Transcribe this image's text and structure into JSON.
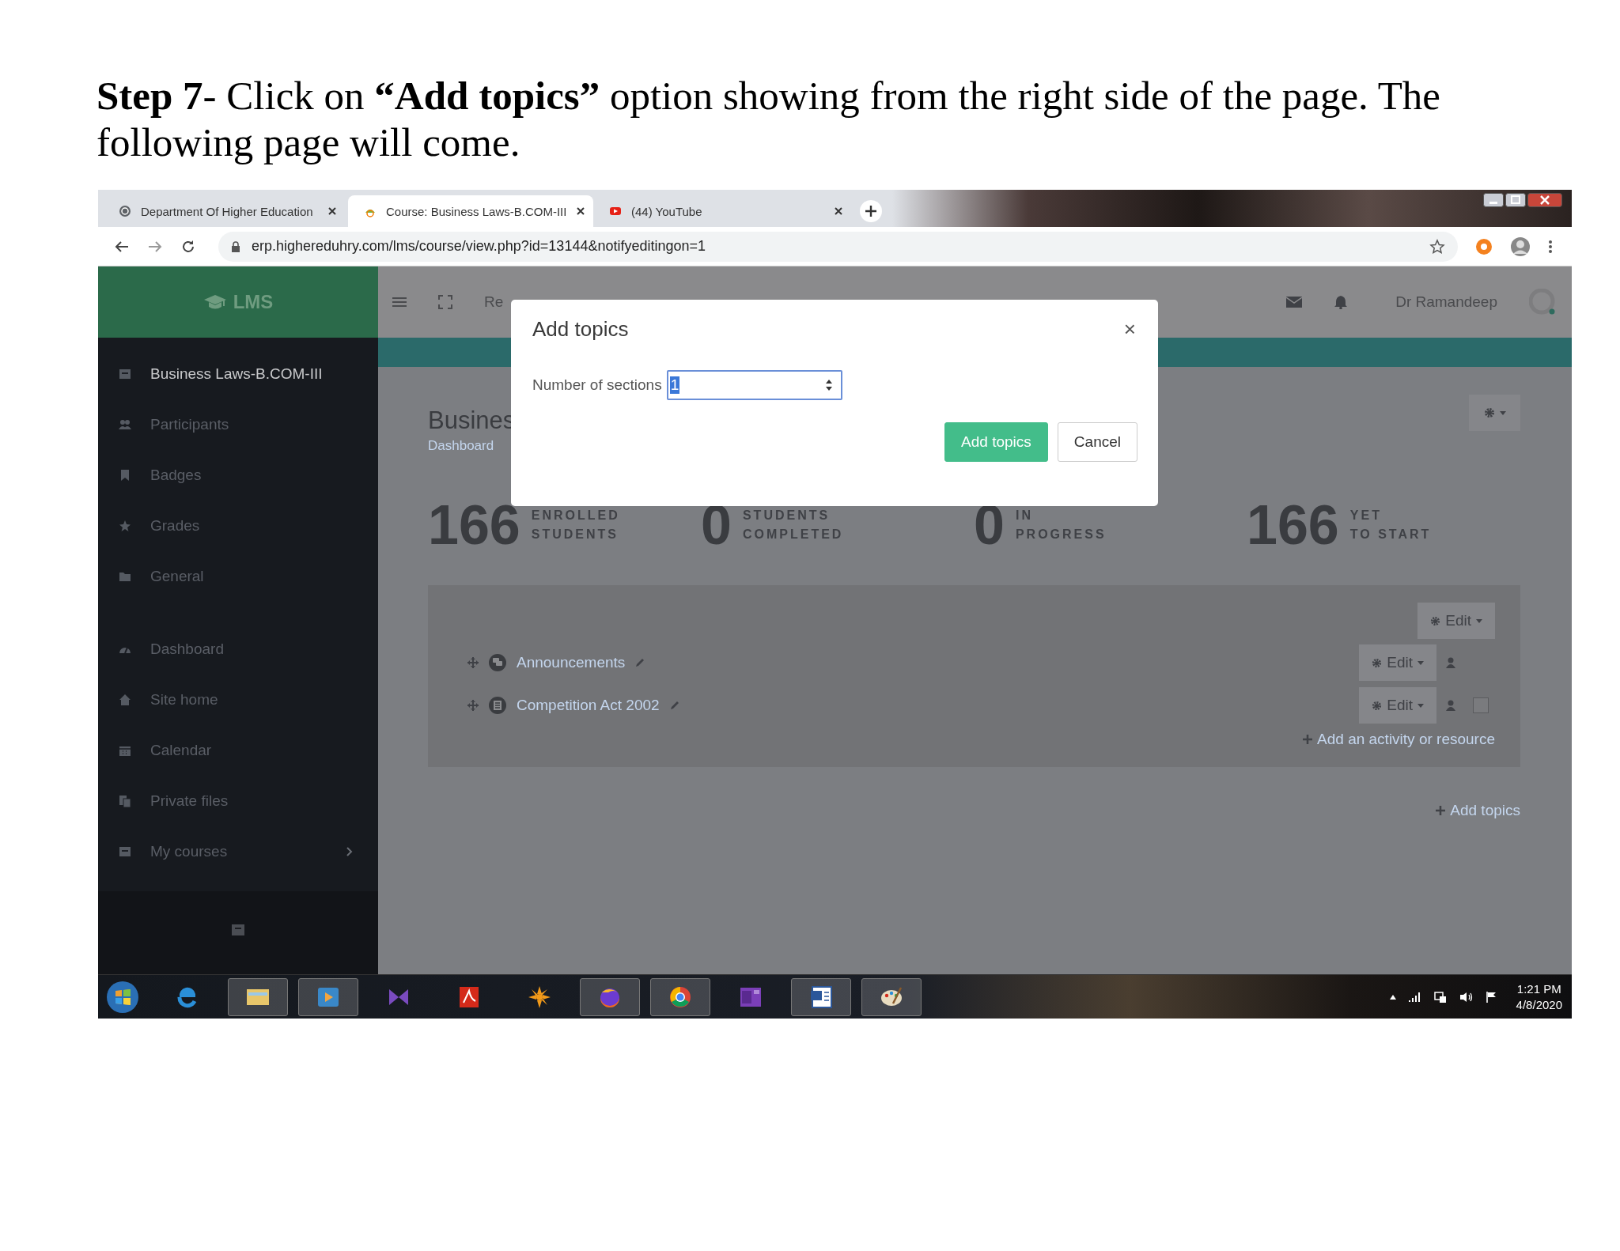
{
  "document": {
    "heading": "**Step 7**- Click on **“Add topics”** option showing from the right side of the page. The following page will come."
  },
  "browser": {
    "tabs": [
      {
        "title": "Department Of Higher Education",
        "selected": false
      },
      {
        "title": "Course: Business Laws-B.COM-III",
        "selected": true
      },
      {
        "title": "(44) YouTube",
        "selected": false
      }
    ],
    "url": "erp.highereduhry.com/lms/course/view.php?id=13144&notifyeditingon=1"
  },
  "lms": {
    "brand": "LMS",
    "topbar": {
      "cut_text": "Re",
      "user": "Dr Ramandeep"
    },
    "sidebar": {
      "course_items": [
        {
          "label": "Business Laws-B.COM-III",
          "selected": true,
          "expandable": false
        },
        {
          "label": "Participants",
          "selected": false,
          "expandable": false
        },
        {
          "label": "Badges",
          "selected": false,
          "expandable": false
        },
        {
          "label": "Grades",
          "selected": false,
          "expandable": false
        },
        {
          "label": "General",
          "selected": false,
          "expandable": false
        }
      ],
      "site_items": [
        {
          "label": "Dashboard",
          "selected": false,
          "expandable": false
        },
        {
          "label": "Site home",
          "selected": false,
          "expandable": false
        },
        {
          "label": "Calendar",
          "selected": false,
          "expandable": false
        },
        {
          "label": "Private files",
          "selected": false,
          "expandable": false
        },
        {
          "label": "My courses",
          "selected": false,
          "expandable": true
        }
      ]
    },
    "page": {
      "title": "Busines",
      "breadcrumb": "Dashboard",
      "stats": [
        {
          "number": "166",
          "lines": [
            "ENROLLED",
            "STUDENTS"
          ]
        },
        {
          "number": "0",
          "lines": [
            "STUDENTS",
            "COMPLETED"
          ]
        },
        {
          "number": "0",
          "lines": [
            "IN",
            "PROGRESS"
          ]
        },
        {
          "number": "166",
          "lines": [
            "YET",
            "TO START"
          ]
        }
      ],
      "section": {
        "edit": "Edit",
        "activities": [
          {
            "name": "Announcements",
            "edit": "Edit",
            "kind": "plain"
          },
          {
            "name": "Competition Act 2002",
            "edit": "Edit",
            "kind": "completion",
            "checked": false
          }
        ],
        "add_activity": "Add an activity or resource"
      },
      "add_topics": "Add topics"
    }
  },
  "dialog": {
    "title": "Add topics",
    "close": "×",
    "field_label": "Number of sections",
    "value": "1",
    "buttons": [
      {
        "label": "Add topics",
        "kind": "primary"
      },
      {
        "label": "Cancel",
        "kind": "secondary"
      }
    ]
  },
  "taskbar": {
    "time": "1:21 PM",
    "date": "4/8/2020"
  }
}
